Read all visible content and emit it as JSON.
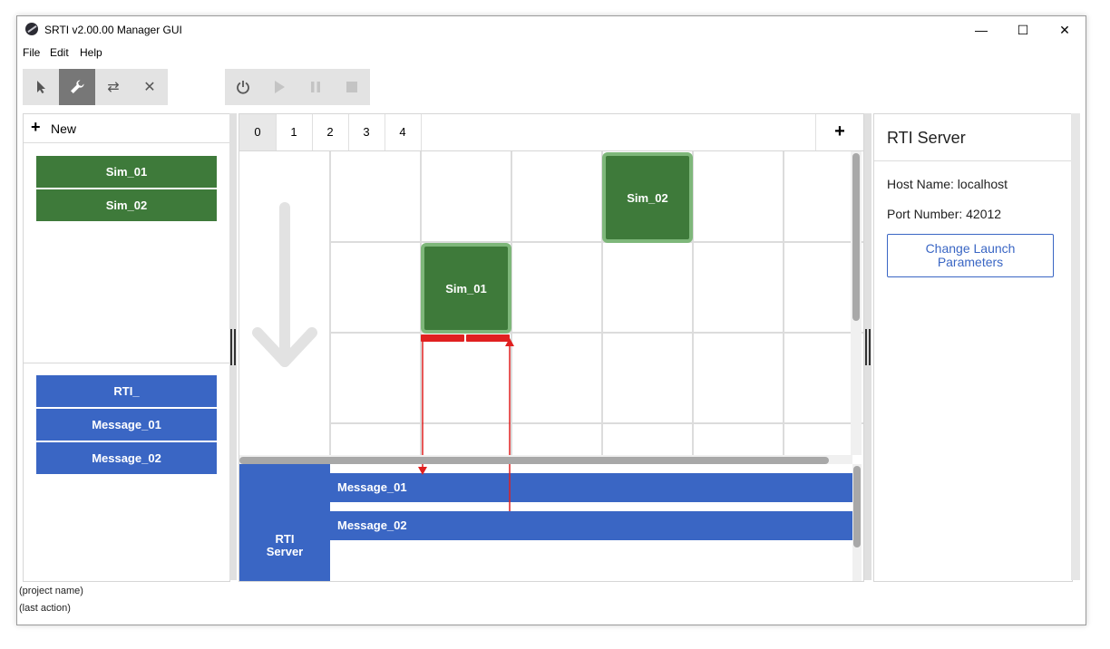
{
  "window": {
    "title": "SRTI v2.00.00 Manager GUI"
  },
  "window_controls": {
    "minimize": "—",
    "maximize": "☐",
    "close": "✕"
  },
  "menu": [
    "File",
    "Edit",
    "Help"
  ],
  "toolbar": {
    "mode_tools": [
      {
        "name": "select-tool",
        "glyph": "➤",
        "active": false
      },
      {
        "name": "edit-tool",
        "glyph": "🔧",
        "active": true
      },
      {
        "name": "connect-tool",
        "glyph": "⇄",
        "active": false
      },
      {
        "name": "delete-tool",
        "glyph": "✕",
        "active": false
      }
    ],
    "run_controls": [
      {
        "name": "power",
        "glyph": "⏻",
        "enabled": true
      },
      {
        "name": "play",
        "glyph": "▶",
        "enabled": false
      },
      {
        "name": "pause",
        "glyph": "❚❚",
        "enabled": false
      },
      {
        "name": "stop",
        "glyph": "■",
        "enabled": false
      }
    ]
  },
  "left_panel": {
    "new_label": "New",
    "simulators": [
      "Sim_01",
      "Sim_02"
    ],
    "messages": [
      "RTI_",
      "Message_01",
      "Message_02"
    ]
  },
  "canvas": {
    "tabs": [
      "0",
      "1",
      "2",
      "3",
      "4"
    ],
    "selected_tab": "0",
    "add_tab": "+",
    "nodes": [
      {
        "label": "Sim_02",
        "col": 4,
        "row": 0
      },
      {
        "label": "Sim_01",
        "col": 2,
        "row": 1
      }
    ],
    "rti_server": "RTI Server",
    "message_bars": [
      "Message_01",
      "Message_02"
    ]
  },
  "right_panel": {
    "title": "RTI Server",
    "host_name": "Host Name: localhost",
    "port_number": "Port Number: 42012",
    "change_button": "Change Launch Parameters"
  },
  "status": {
    "project": "(project name)",
    "last_action": "(last action)"
  },
  "colors": {
    "sim_green": "#3e7a3a",
    "sim_border": "#7eb77a",
    "msg_blue": "#3a66c4",
    "link_red": "#e02020"
  }
}
